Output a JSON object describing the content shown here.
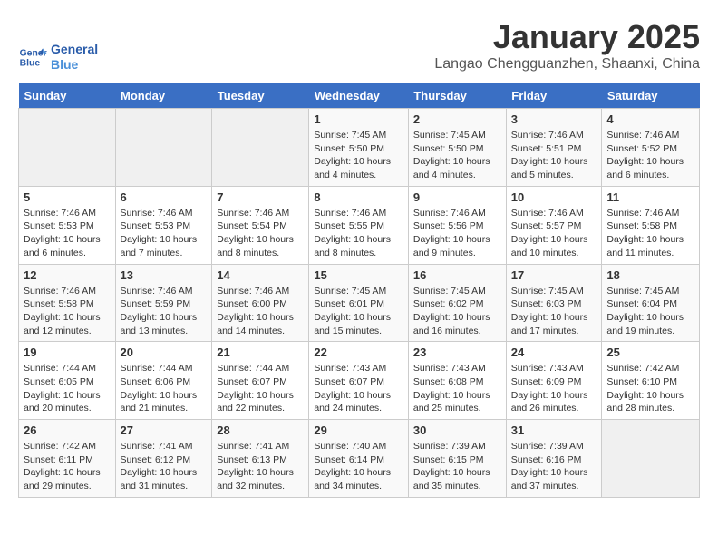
{
  "header": {
    "logo_line1": "General",
    "logo_line2": "Blue",
    "title": "January 2025",
    "subtitle": "Langao Chengguanzhen, Shaanxi, China"
  },
  "weekdays": [
    "Sunday",
    "Monday",
    "Tuesday",
    "Wednesday",
    "Thursday",
    "Friday",
    "Saturday"
  ],
  "weeks": [
    [
      {
        "day": "",
        "sunrise": "",
        "sunset": "",
        "daylight": ""
      },
      {
        "day": "",
        "sunrise": "",
        "sunset": "",
        "daylight": ""
      },
      {
        "day": "",
        "sunrise": "",
        "sunset": "",
        "daylight": ""
      },
      {
        "day": "1",
        "sunrise": "Sunrise: 7:45 AM",
        "sunset": "Sunset: 5:50 PM",
        "daylight": "Daylight: 10 hours and 4 minutes."
      },
      {
        "day": "2",
        "sunrise": "Sunrise: 7:45 AM",
        "sunset": "Sunset: 5:50 PM",
        "daylight": "Daylight: 10 hours and 4 minutes."
      },
      {
        "day": "3",
        "sunrise": "Sunrise: 7:46 AM",
        "sunset": "Sunset: 5:51 PM",
        "daylight": "Daylight: 10 hours and 5 minutes."
      },
      {
        "day": "4",
        "sunrise": "Sunrise: 7:46 AM",
        "sunset": "Sunset: 5:52 PM",
        "daylight": "Daylight: 10 hours and 6 minutes."
      }
    ],
    [
      {
        "day": "5",
        "sunrise": "Sunrise: 7:46 AM",
        "sunset": "Sunset: 5:53 PM",
        "daylight": "Daylight: 10 hours and 6 minutes."
      },
      {
        "day": "6",
        "sunrise": "Sunrise: 7:46 AM",
        "sunset": "Sunset: 5:53 PM",
        "daylight": "Daylight: 10 hours and 7 minutes."
      },
      {
        "day": "7",
        "sunrise": "Sunrise: 7:46 AM",
        "sunset": "Sunset: 5:54 PM",
        "daylight": "Daylight: 10 hours and 8 minutes."
      },
      {
        "day": "8",
        "sunrise": "Sunrise: 7:46 AM",
        "sunset": "Sunset: 5:55 PM",
        "daylight": "Daylight: 10 hours and 8 minutes."
      },
      {
        "day": "9",
        "sunrise": "Sunrise: 7:46 AM",
        "sunset": "Sunset: 5:56 PM",
        "daylight": "Daylight: 10 hours and 9 minutes."
      },
      {
        "day": "10",
        "sunrise": "Sunrise: 7:46 AM",
        "sunset": "Sunset: 5:57 PM",
        "daylight": "Daylight: 10 hours and 10 minutes."
      },
      {
        "day": "11",
        "sunrise": "Sunrise: 7:46 AM",
        "sunset": "Sunset: 5:58 PM",
        "daylight": "Daylight: 10 hours and 11 minutes."
      }
    ],
    [
      {
        "day": "12",
        "sunrise": "Sunrise: 7:46 AM",
        "sunset": "Sunset: 5:58 PM",
        "daylight": "Daylight: 10 hours and 12 minutes."
      },
      {
        "day": "13",
        "sunrise": "Sunrise: 7:46 AM",
        "sunset": "Sunset: 5:59 PM",
        "daylight": "Daylight: 10 hours and 13 minutes."
      },
      {
        "day": "14",
        "sunrise": "Sunrise: 7:46 AM",
        "sunset": "Sunset: 6:00 PM",
        "daylight": "Daylight: 10 hours and 14 minutes."
      },
      {
        "day": "15",
        "sunrise": "Sunrise: 7:45 AM",
        "sunset": "Sunset: 6:01 PM",
        "daylight": "Daylight: 10 hours and 15 minutes."
      },
      {
        "day": "16",
        "sunrise": "Sunrise: 7:45 AM",
        "sunset": "Sunset: 6:02 PM",
        "daylight": "Daylight: 10 hours and 16 minutes."
      },
      {
        "day": "17",
        "sunrise": "Sunrise: 7:45 AM",
        "sunset": "Sunset: 6:03 PM",
        "daylight": "Daylight: 10 hours and 17 minutes."
      },
      {
        "day": "18",
        "sunrise": "Sunrise: 7:45 AM",
        "sunset": "Sunset: 6:04 PM",
        "daylight": "Daylight: 10 hours and 19 minutes."
      }
    ],
    [
      {
        "day": "19",
        "sunrise": "Sunrise: 7:44 AM",
        "sunset": "Sunset: 6:05 PM",
        "daylight": "Daylight: 10 hours and 20 minutes."
      },
      {
        "day": "20",
        "sunrise": "Sunrise: 7:44 AM",
        "sunset": "Sunset: 6:06 PM",
        "daylight": "Daylight: 10 hours and 21 minutes."
      },
      {
        "day": "21",
        "sunrise": "Sunrise: 7:44 AM",
        "sunset": "Sunset: 6:07 PM",
        "daylight": "Daylight: 10 hours and 22 minutes."
      },
      {
        "day": "22",
        "sunrise": "Sunrise: 7:43 AM",
        "sunset": "Sunset: 6:07 PM",
        "daylight": "Daylight: 10 hours and 24 minutes."
      },
      {
        "day": "23",
        "sunrise": "Sunrise: 7:43 AM",
        "sunset": "Sunset: 6:08 PM",
        "daylight": "Daylight: 10 hours and 25 minutes."
      },
      {
        "day": "24",
        "sunrise": "Sunrise: 7:43 AM",
        "sunset": "Sunset: 6:09 PM",
        "daylight": "Daylight: 10 hours and 26 minutes."
      },
      {
        "day": "25",
        "sunrise": "Sunrise: 7:42 AM",
        "sunset": "Sunset: 6:10 PM",
        "daylight": "Daylight: 10 hours and 28 minutes."
      }
    ],
    [
      {
        "day": "26",
        "sunrise": "Sunrise: 7:42 AM",
        "sunset": "Sunset: 6:11 PM",
        "daylight": "Daylight: 10 hours and 29 minutes."
      },
      {
        "day": "27",
        "sunrise": "Sunrise: 7:41 AM",
        "sunset": "Sunset: 6:12 PM",
        "daylight": "Daylight: 10 hours and 31 minutes."
      },
      {
        "day": "28",
        "sunrise": "Sunrise: 7:41 AM",
        "sunset": "Sunset: 6:13 PM",
        "daylight": "Daylight: 10 hours and 32 minutes."
      },
      {
        "day": "29",
        "sunrise": "Sunrise: 7:40 AM",
        "sunset": "Sunset: 6:14 PM",
        "daylight": "Daylight: 10 hours and 34 minutes."
      },
      {
        "day": "30",
        "sunrise": "Sunrise: 7:39 AM",
        "sunset": "Sunset: 6:15 PM",
        "daylight": "Daylight: 10 hours and 35 minutes."
      },
      {
        "day": "31",
        "sunrise": "Sunrise: 7:39 AM",
        "sunset": "Sunset: 6:16 PM",
        "daylight": "Daylight: 10 hours and 37 minutes."
      },
      {
        "day": "",
        "sunrise": "",
        "sunset": "",
        "daylight": ""
      }
    ]
  ]
}
